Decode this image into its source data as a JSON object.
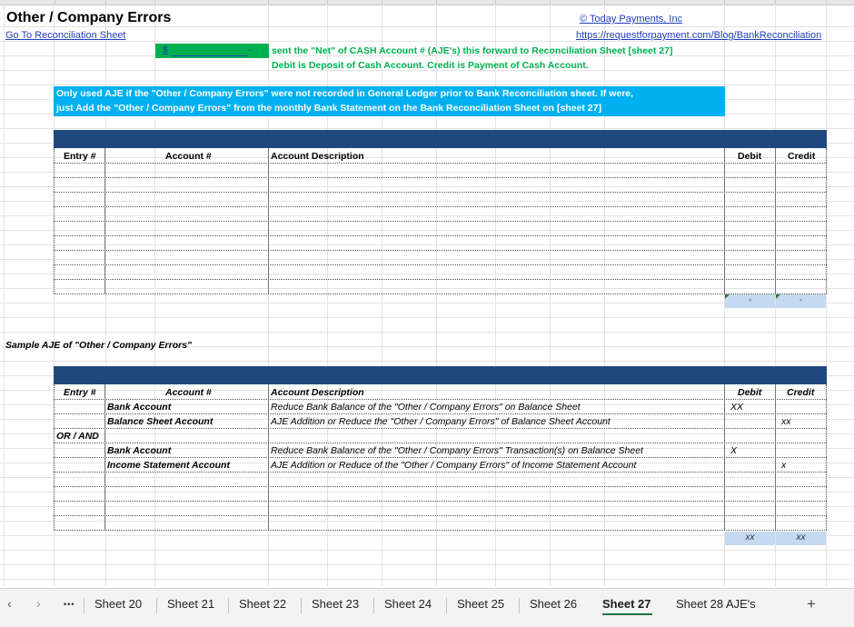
{
  "sheet": {
    "title": "Other / Company Errors",
    "goto_link": "Go To Reconciliation Sheet",
    "copyright": "© Today Payments, Inc",
    "url": "https://requestforpayment.com/Blog/BankReconciliation",
    "net_value_symbol": "$",
    "net_value": "-",
    "green_note_1": "sent the \"Net\" of CASH Account # (AJE's) this forward to Reconciliation Sheet [sheet 27]",
    "green_note_2": "Debit is Deposit of Cash Account.  Credit is Payment of Cash Account.",
    "info_line_1": "Only used AJE if the \"Other / Company Errors\" were not recorded in General Ledger prior to Bank Reconciliation sheet.  If were,",
    "info_line_2": "just Add the \"Other / Company Errors\" from the monthly Bank Statement on the Bank Reconciliation Sheet on [sheet 27]"
  },
  "table1": {
    "headers": {
      "entry": "Entry #",
      "account": "Account #",
      "description": "Account Description",
      "debit": "Debit",
      "credit": "Credit"
    },
    "debit_total": "-",
    "credit_total": "-"
  },
  "sample": {
    "caption": "Sample AJE of \"Other / Company Errors\"",
    "headers": {
      "entry": "Entry #",
      "account": "Account #",
      "description": "Account Description",
      "debit": "Debit",
      "credit": "Credit"
    },
    "row1": {
      "account": "Bank Account",
      "description": "Reduce Bank Balance of the \"Other / Company Errors\" on Balance Sheet",
      "debit": "XX",
      "credit": ""
    },
    "row2": {
      "account": "Balance Sheet Account",
      "description": "AJE Addition or Reduce the \"Other / Company Errors\" of Balance Sheet Account",
      "debit": "",
      "credit": "xx"
    },
    "or_and": "OR / AND",
    "row3": {
      "account": "Bank Account",
      "description": "Reduce Bank Balance of the \"Other / Company Errors\" Transaction(s) on Balance Sheet",
      "debit": "X",
      "credit": ""
    },
    "row4": {
      "account": "Income Statement Account",
      "description": "AJE Addition or Reduce of the \"Other / Company Errors\" of Income Statement Account",
      "debit": "",
      "credit": "x"
    },
    "debit_total": "xx",
    "credit_total": "xx"
  },
  "tabs": {
    "ellipsis": "•••",
    "items": [
      "Sheet 20",
      "Sheet 21",
      "Sheet 22",
      "Sheet 23",
      "Sheet 24",
      "Sheet 25",
      "Sheet 26",
      "Sheet 27",
      "Sheet 28 AJE's"
    ],
    "active": "Sheet 27",
    "add": "+"
  },
  "colors": {
    "navy": "#1f497d",
    "cyan": "#00b0f0",
    "green": "#00b050",
    "total_fill": "#c5d9f1"
  }
}
